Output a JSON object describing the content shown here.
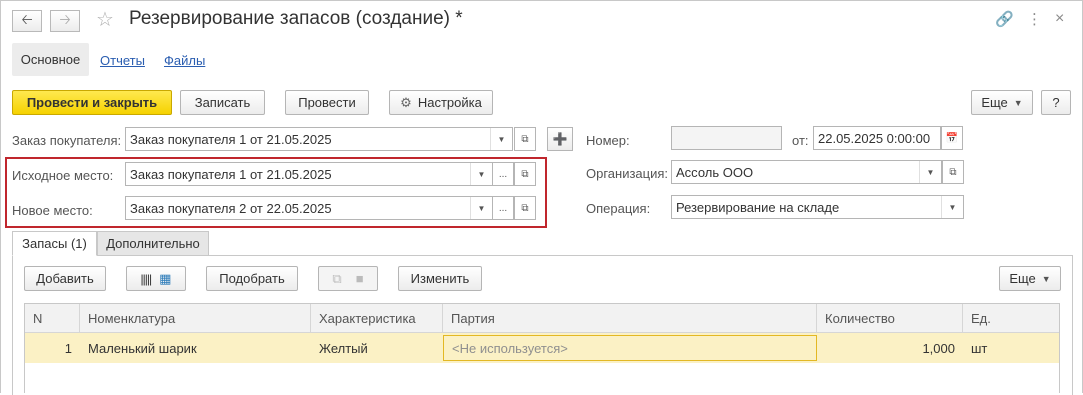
{
  "window": {
    "title": "Резервирование запасов (создание) *",
    "back_icon": "arrow-left-icon",
    "forward_icon": "arrow-right-icon"
  },
  "tabs": [
    "Основное",
    "Отчеты",
    "Файлы"
  ],
  "toolbar": {
    "post_close": "Провести и закрыть",
    "save": "Записать",
    "post": "Провести",
    "settings": "Настройка",
    "more": "Еще",
    "help": "?"
  },
  "form": {
    "order_label": "Заказ покупателя:",
    "order_value": "Заказ покупателя 1 от 21.05.2025",
    "source_label": "Исходное место:",
    "source_value": "Заказ покупателя 1 от 21.05.2025",
    "dest_label": "Новое место:",
    "dest_value": "Заказ покупателя 2 от 22.05.2025",
    "number_label": "Номер:",
    "number_value": "",
    "from_label": "от:",
    "date_value": "22.05.2025  0:00:00",
    "org_label": "Организация:",
    "org_value": "Ассоль ООО",
    "op_label": "Операция:",
    "op_value": "Резервирование на складе"
  },
  "inner_tabs": [
    "Запасы (1)",
    "Дополнительно"
  ],
  "table_toolbar": {
    "add": "Добавить",
    "pick": "Подобрать",
    "change": "Изменить",
    "more": "Еще"
  },
  "table": {
    "columns": [
      "N",
      "Номенклатура",
      "Характеристика",
      "Партия",
      "Количество",
      "Ед."
    ],
    "rows": [
      [
        "1",
        "Маленький шарик",
        "Желтый",
        "<Не используется>",
        "1,000",
        "шт"
      ]
    ]
  }
}
